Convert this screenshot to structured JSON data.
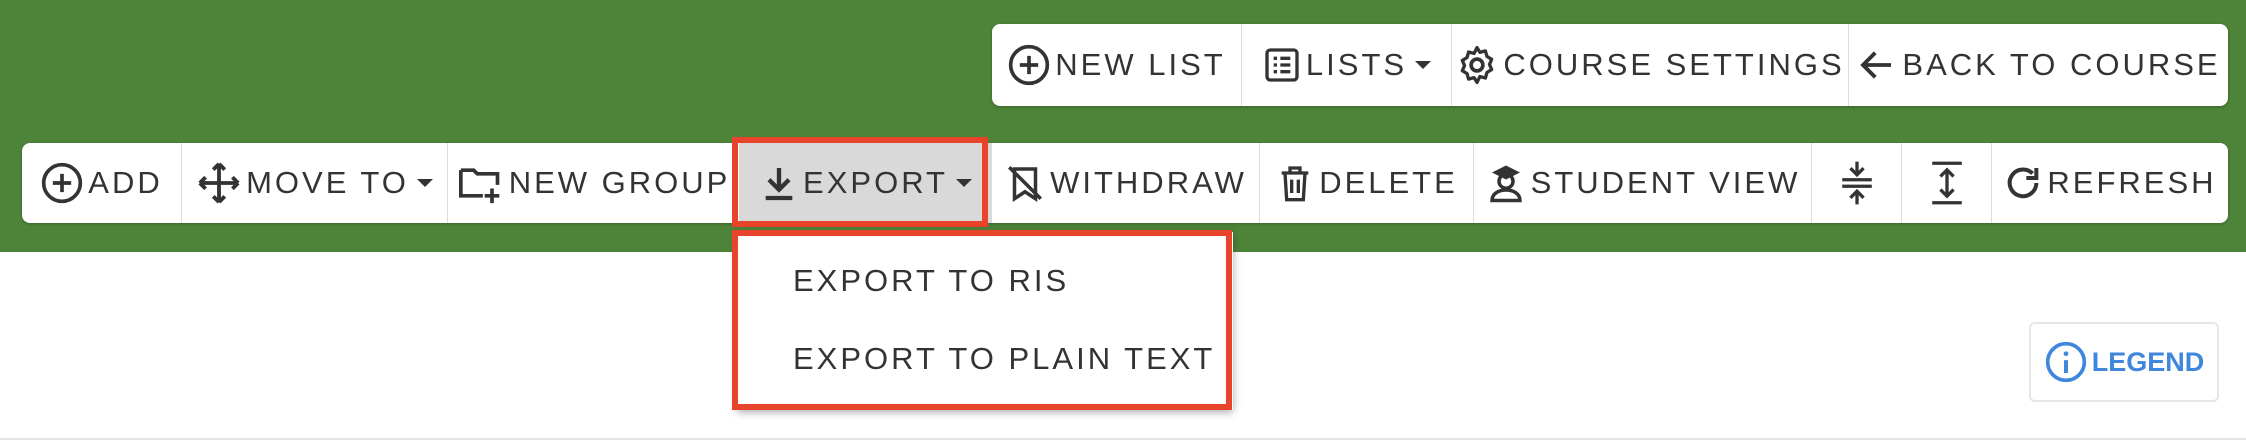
{
  "colors": {
    "banner": "#4e843a",
    "highlight": "#e8432b",
    "accent": "#3f86dd"
  },
  "top_toolbar": {
    "new_list": {
      "label": "NEW LIST",
      "icon": "plus-circle-icon"
    },
    "lists": {
      "label": "LISTS",
      "icon": "list-icon",
      "has_dropdown": true
    },
    "course_settings": {
      "label": "COURSE SETTINGS",
      "icon": "gear-icon"
    },
    "back_to_course": {
      "label": "BACK TO COURSE",
      "icon": "arrow-left-icon"
    }
  },
  "main_toolbar": {
    "add": {
      "label": "ADD",
      "icon": "plus-circle-icon"
    },
    "move_to": {
      "label": "MOVE TO",
      "icon": "move-icon",
      "has_dropdown": true
    },
    "new_group": {
      "label": "NEW GROUP",
      "icon": "folder-plus-icon"
    },
    "export": {
      "label": "EXPORT",
      "icon": "download-icon",
      "has_dropdown": true,
      "active": true
    },
    "withdraw": {
      "label": "WITHDRAW",
      "icon": "bookmark-off-icon"
    },
    "delete": {
      "label": "DELETE",
      "icon": "trash-icon"
    },
    "student_view": {
      "label": "STUDENT VIEW",
      "icon": "student-icon"
    },
    "collapse": {
      "label": "",
      "icon": "collapse-vertical-icon"
    },
    "expand": {
      "label": "",
      "icon": "expand-vertical-icon"
    },
    "refresh": {
      "label": "REFRESH",
      "icon": "refresh-icon"
    }
  },
  "export_menu": {
    "items": [
      {
        "label": "EXPORT TO RIS"
      },
      {
        "label": "EXPORT TO PLAIN TEXT"
      }
    ]
  },
  "legend_button": {
    "label": "LEGEND",
    "icon": "info-icon"
  }
}
